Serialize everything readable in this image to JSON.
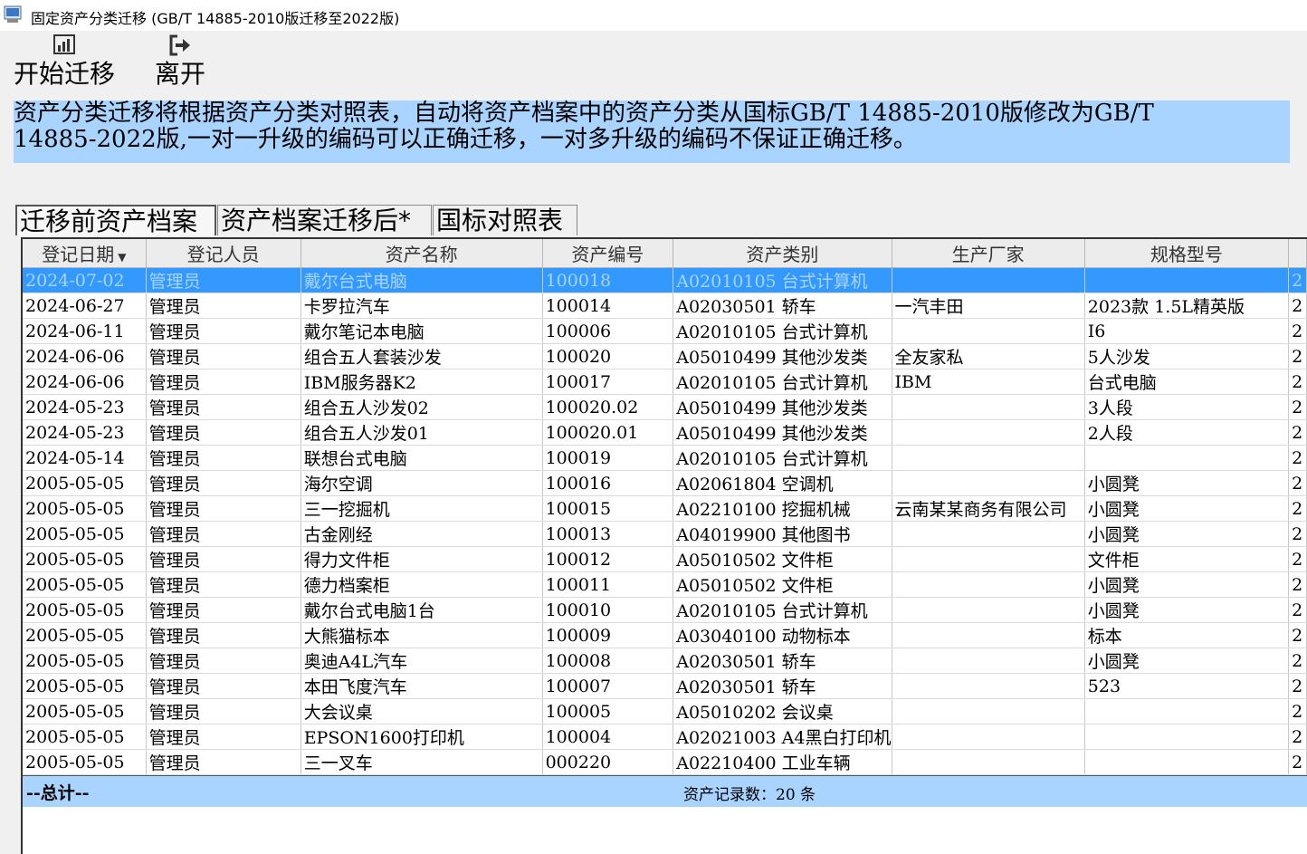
{
  "window": {
    "title": "固定资产分类迁移 (GB/T 14885-2010版迁移至2022版)"
  },
  "toolbar": {
    "start_label": "开始迁移",
    "exit_label": "离开",
    "start_icon": "chart-icon",
    "exit_icon": "exit-icon"
  },
  "notice": {
    "line1": "资产分类迁移将根据资产分类对照表，自动将资产档案中的资产分类从国标GB/T 14885-2010版修改为GB/T",
    "line2": "14885-2022版,一对一升级的编码可以正确迁移，一对多升级的编码不保证正确迁移。",
    "background": "#a9d4ff"
  },
  "tabs": [
    {
      "label": "迁移前资产档案",
      "active": true
    },
    {
      "label": "资产档案迁移后*",
      "active": false
    },
    {
      "label": "国标对照表",
      "active": false
    }
  ],
  "table": {
    "columns": [
      "登记日期",
      "登记人员",
      "资产名称",
      "资产编号",
      "资产类别",
      "生产厂家",
      "规格型号"
    ],
    "sort_column": "登记日期",
    "selected_row": 0,
    "rows": [
      [
        "2024-07-02",
        "管理员",
        "戴尔台式电脑",
        "100018",
        "A02010105 台式计算机",
        "",
        "",
        "2"
      ],
      [
        "2024-06-27",
        "管理员",
        "卡罗拉汽车",
        "100014",
        "A02030501 轿车",
        "一汽丰田",
        "2023款 1.5L精英版",
        "2"
      ],
      [
        "2024-06-11",
        "管理员",
        "戴尔笔记本电脑",
        "100006",
        "A02010105 台式计算机",
        "",
        "I6",
        "2"
      ],
      [
        "2024-06-06",
        "管理员",
        "组合五人套装沙发",
        "100020",
        "A05010499 其他沙发类",
        "全友家私",
        "5人沙发",
        "2"
      ],
      [
        "2024-06-06",
        "管理员",
        "IBM服务器K2",
        "100017",
        "A02010105 台式计算机",
        "IBM",
        "台式电脑",
        "2"
      ],
      [
        "2024-05-23",
        "管理员",
        "组合五人沙发02",
        "100020.02",
        "A05010499 其他沙发类",
        "",
        "3人段",
        "2"
      ],
      [
        "2024-05-23",
        "管理员",
        "组合五人沙发01",
        "100020.01",
        "A05010499 其他沙发类",
        "",
        "2人段",
        "2"
      ],
      [
        "2024-05-14",
        "管理员",
        "联想台式电脑",
        "100019",
        "A02010105 台式计算机",
        "",
        "",
        "2"
      ],
      [
        "2005-05-05",
        "管理员",
        "海尔空调",
        "100016",
        "A02061804 空调机",
        "",
        "小圆凳",
        "2"
      ],
      [
        "2005-05-05",
        "管理员",
        "三一挖掘机",
        "100015",
        "A02210100 挖掘机械",
        "云南某某商务有限公司",
        "小圆凳",
        "2"
      ],
      [
        "2005-05-05",
        "管理员",
        "古金刚经",
        "100013",
        "A04019900 其他图书",
        "",
        "小圆凳",
        "2"
      ],
      [
        "2005-05-05",
        "管理员",
        "得力文件柜",
        "100012",
        "A05010502 文件柜",
        "",
        "文件柜",
        "2"
      ],
      [
        "2005-05-05",
        "管理员",
        "德力档案柜",
        "100011",
        "A05010502 文件柜",
        "",
        "小圆凳",
        "2"
      ],
      [
        "2005-05-05",
        "管理员",
        "戴尔台式电脑1台",
        "100010",
        "A02010105 台式计算机",
        "",
        "小圆凳",
        "2"
      ],
      [
        "2005-05-05",
        "管理员",
        "大熊猫标本",
        "100009",
        "A03040100 动物标本",
        "",
        "标本",
        "2"
      ],
      [
        "2005-05-05",
        "管理员",
        "奥迪A4L汽车",
        "100008",
        "A02030501 轿车",
        "",
        "小圆凳",
        "2"
      ],
      [
        "2005-05-05",
        "管理员",
        "本田飞度汽车",
        "100007",
        "A02030501 轿车",
        "",
        "523",
        "2"
      ],
      [
        "2005-05-05",
        "管理员",
        "大会议桌",
        "100005",
        "A05010202 会议桌",
        "",
        "",
        "2"
      ],
      [
        "2005-05-05",
        "管理员",
        "EPSON1600打印机",
        "100004",
        "A02021003 A4黑白打印机",
        "",
        "",
        "2"
      ],
      [
        "2005-05-05",
        "管理员",
        "三一叉车",
        "000220",
        "A02210400 工业车辆",
        "",
        "",
        "2"
      ]
    ]
  },
  "totals": {
    "label": "--总计--",
    "count_text": "资产记录数：20 条"
  }
}
